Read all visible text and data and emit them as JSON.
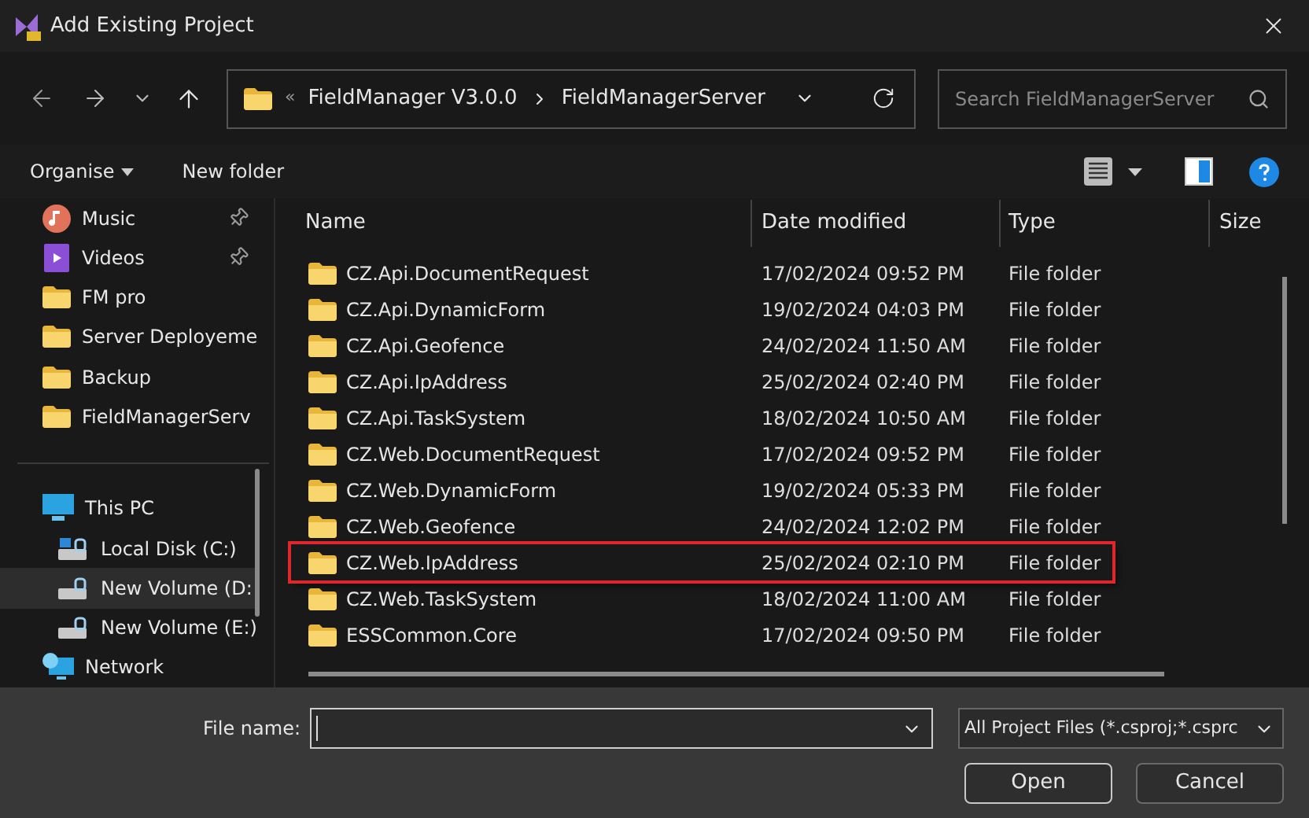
{
  "window": {
    "title": "Add Existing Project"
  },
  "address_bar": {
    "overflow": "«",
    "segments": [
      "FieldManager V3.0.0",
      "FieldManagerServer"
    ]
  },
  "search": {
    "placeholder": "Search FieldManagerServer"
  },
  "toolbar": {
    "organise": "Organise",
    "new_folder": "New folder"
  },
  "sidebar": {
    "quick_access": [
      {
        "label": "Music",
        "kind": "music",
        "pinned": true,
        "selected": false
      },
      {
        "label": "Videos",
        "kind": "videos",
        "pinned": true,
        "selected": false
      },
      {
        "label": "FM pro",
        "kind": "folder",
        "pinned": false,
        "selected": false
      },
      {
        "label": "Server Deployeme",
        "kind": "folder",
        "pinned": false,
        "selected": false
      },
      {
        "label": "Backup",
        "kind": "folder",
        "pinned": false,
        "selected": false
      },
      {
        "label": "FieldManagerServ",
        "kind": "folder",
        "pinned": false,
        "selected": false
      }
    ],
    "locations": [
      {
        "label": "This PC",
        "kind": "pc",
        "selected": false,
        "children": [
          {
            "label": "Local Disk (C:)",
            "kind": "system-drive",
            "selected": false
          },
          {
            "label": "New Volume (D:",
            "kind": "drive",
            "selected": true
          },
          {
            "label": "New Volume (E:)",
            "kind": "drive",
            "selected": false
          }
        ]
      },
      {
        "label": "Network",
        "kind": "network",
        "selected": false
      }
    ]
  },
  "table": {
    "columns": [
      "Name",
      "Date modified",
      "Type",
      "Size"
    ],
    "rows": [
      {
        "name": "CZ.Api.DocumentRequest",
        "date": "17/02/2024 09:52 PM",
        "type": "File folder",
        "highlighted": false
      },
      {
        "name": "CZ.Api.DynamicForm",
        "date": "19/02/2024 04:03 PM",
        "type": "File folder",
        "highlighted": false
      },
      {
        "name": "CZ.Api.Geofence",
        "date": "24/02/2024 11:50 AM",
        "type": "File folder",
        "highlighted": false
      },
      {
        "name": "CZ.Api.IpAddress",
        "date": "25/02/2024 02:40 PM",
        "type": "File folder",
        "highlighted": false
      },
      {
        "name": "CZ.Api.TaskSystem",
        "date": "18/02/2024 10:50 AM",
        "type": "File folder",
        "highlighted": false
      },
      {
        "name": "CZ.Web.DocumentRequest",
        "date": "17/02/2024 09:52 PM",
        "type": "File folder",
        "highlighted": false
      },
      {
        "name": "CZ.Web.DynamicForm",
        "date": "19/02/2024 05:33 PM",
        "type": "File folder",
        "highlighted": false
      },
      {
        "name": "CZ.Web.Geofence",
        "date": "24/02/2024 12:02 PM",
        "type": "File folder",
        "highlighted": false
      },
      {
        "name": "CZ.Web.IpAddress",
        "date": "25/02/2024 02:10 PM",
        "type": "File folder",
        "highlighted": true
      },
      {
        "name": "CZ.Web.TaskSystem",
        "date": "18/02/2024 11:00 AM",
        "type": "File folder",
        "highlighted": false
      },
      {
        "name": "ESSCommon.Core",
        "date": "17/02/2024 09:50 PM",
        "type": "File folder",
        "highlighted": false
      }
    ]
  },
  "footer": {
    "file_name_label": "File name:",
    "filter": "All Project Files (*.csproj;*.csprc",
    "buttons": [
      {
        "label": "Open",
        "default": true
      },
      {
        "label": "Cancel",
        "default": false
      }
    ]
  }
}
